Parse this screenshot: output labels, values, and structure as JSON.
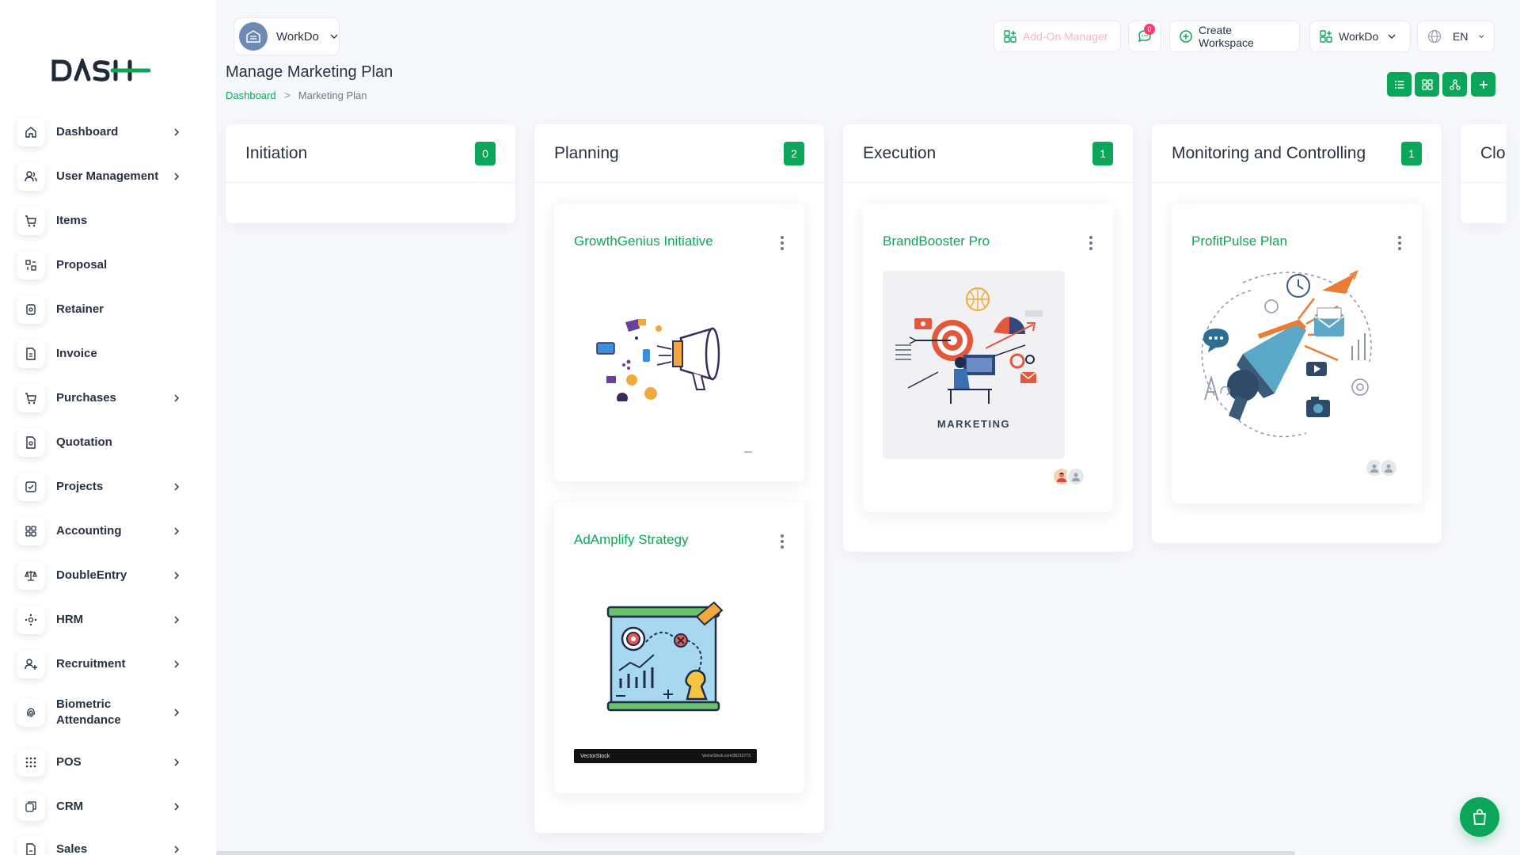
{
  "app": {
    "logo_text": "DASH"
  },
  "header": {
    "workspace": "WorkDo",
    "page_title": "Manage Marketing Plan",
    "breadcrumb": {
      "home": "Dashboard",
      "separator": ">",
      "current": "Marketing Plan"
    },
    "addon_manager": "Add-On Manager",
    "chat_badge": "0",
    "create_workspace": "Create Workspace",
    "workspace_switch": "WorkDo",
    "language": "EN"
  },
  "sidebar": {
    "items": [
      {
        "label": "Dashboard",
        "icon": "home-icon",
        "has_children": true
      },
      {
        "label": "User Management",
        "icon": "users-icon",
        "has_children": true
      },
      {
        "label": "Items",
        "icon": "cart-icon",
        "has_children": false
      },
      {
        "label": "Proposal",
        "icon": "proposal-icon",
        "has_children": false
      },
      {
        "label": "Retainer",
        "icon": "retainer-icon",
        "has_children": false
      },
      {
        "label": "Invoice",
        "icon": "invoice-icon",
        "has_children": false
      },
      {
        "label": "Purchases",
        "icon": "cart-icon",
        "has_children": true
      },
      {
        "label": "Quotation",
        "icon": "quotation-icon",
        "has_children": false
      },
      {
        "label": "Projects",
        "icon": "projects-icon",
        "has_children": true
      },
      {
        "label": "Accounting",
        "icon": "grid-icon",
        "has_children": true
      },
      {
        "label": "DoubleEntry",
        "icon": "scale-icon",
        "has_children": true
      },
      {
        "label": "HRM",
        "icon": "hrm-icon",
        "has_children": true
      },
      {
        "label": "Recruitment",
        "icon": "user-plus-icon",
        "has_children": true
      },
      {
        "label": "Biometric Attendance",
        "icon": "fingerprint-icon",
        "has_children": true
      },
      {
        "label": "POS",
        "icon": "dots-grid-icon",
        "has_children": true
      },
      {
        "label": "CRM",
        "icon": "crm-icon",
        "has_children": true
      },
      {
        "label": "Sales",
        "icon": "sales-icon",
        "has_children": true
      }
    ]
  },
  "board": {
    "columns": [
      {
        "title": "Initiation",
        "count": "0",
        "cards": []
      },
      {
        "title": "Planning",
        "count": "2",
        "cards": [
          {
            "title": "GrowthGenius Initiative",
            "image": "megaphone-social-illustration"
          },
          {
            "title": "AdAmplify Strategy",
            "image": "strategy-board-illustration",
            "watermark_left": "VectorStock",
            "watermark_right": "VectorStock.com/36215773"
          }
        ]
      },
      {
        "title": "Execution",
        "count": "1",
        "cards": [
          {
            "title": "BrandBooster Pro",
            "image": "marketing-target-illustration",
            "image_caption": "MARKETING"
          }
        ]
      },
      {
        "title": "Monitoring and Controlling",
        "count": "1",
        "cards": [
          {
            "title": "ProfitPulse Plan",
            "image": "megaphone-media-illustration"
          }
        ]
      },
      {
        "title": "Clo",
        "count": "",
        "cards": []
      }
    ]
  },
  "colors": {
    "accent": "#0ca65a",
    "text": "#293240",
    "background": "#f7f8fc",
    "badge": "#ff3a6e"
  }
}
